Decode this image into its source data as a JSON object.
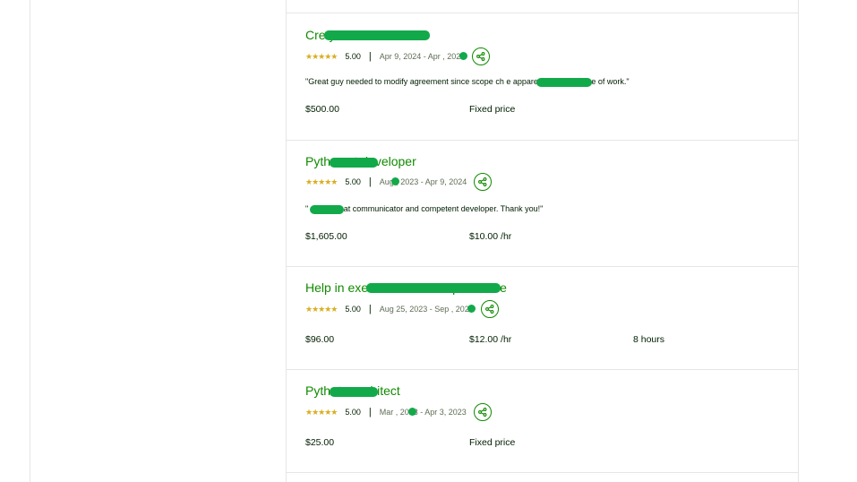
{
  "jobs": [
    {
      "title": "Cre                          y Junkie",
      "rating": "5.00",
      "dates": "Apr 9, 2024 - Apr  , 2024",
      "quote": "\"Great guy needed to modify agreement since scope ch                  e apparent during course of work.\"",
      "amount": "$500.00",
      "rate": "Fixed price",
      "hours": ""
    },
    {
      "title": "Pyth              eact developer",
      "rating": "5.00",
      "dates": "Aug  , 2023 - Apr 9, 2024",
      "quote": "\"          a is a great communicator and competent developer. Thank you!\"",
      "amount": "$1,605.00",
      "rate": "$10.00 /hr",
      "hours": ""
    },
    {
      "title": "Help in exe                                         nd make it simple to use",
      "rating": "5.00",
      "dates": "Aug 25, 2023 - Sep  , 2023",
      "quote": "",
      "amount": "$96.00",
      "rate": "$12.00 /hr",
      "hours": "8 hours"
    },
    {
      "title": "Pyth              rt - architect",
      "rating": "5.00",
      "dates": "Mar  , 2023 - Apr 3, 2023",
      "quote": "",
      "amount": "$25.00",
      "rate": "Fixed price",
      "hours": ""
    }
  ],
  "stars_glyph": "★★★★★",
  "icons": {
    "share": "share-icon",
    "rating": "star-icon"
  },
  "colors": {
    "accent": "#108a00",
    "star": "#d8ae20",
    "redaction": "#12a94a",
    "border": "#e4e6e4"
  }
}
